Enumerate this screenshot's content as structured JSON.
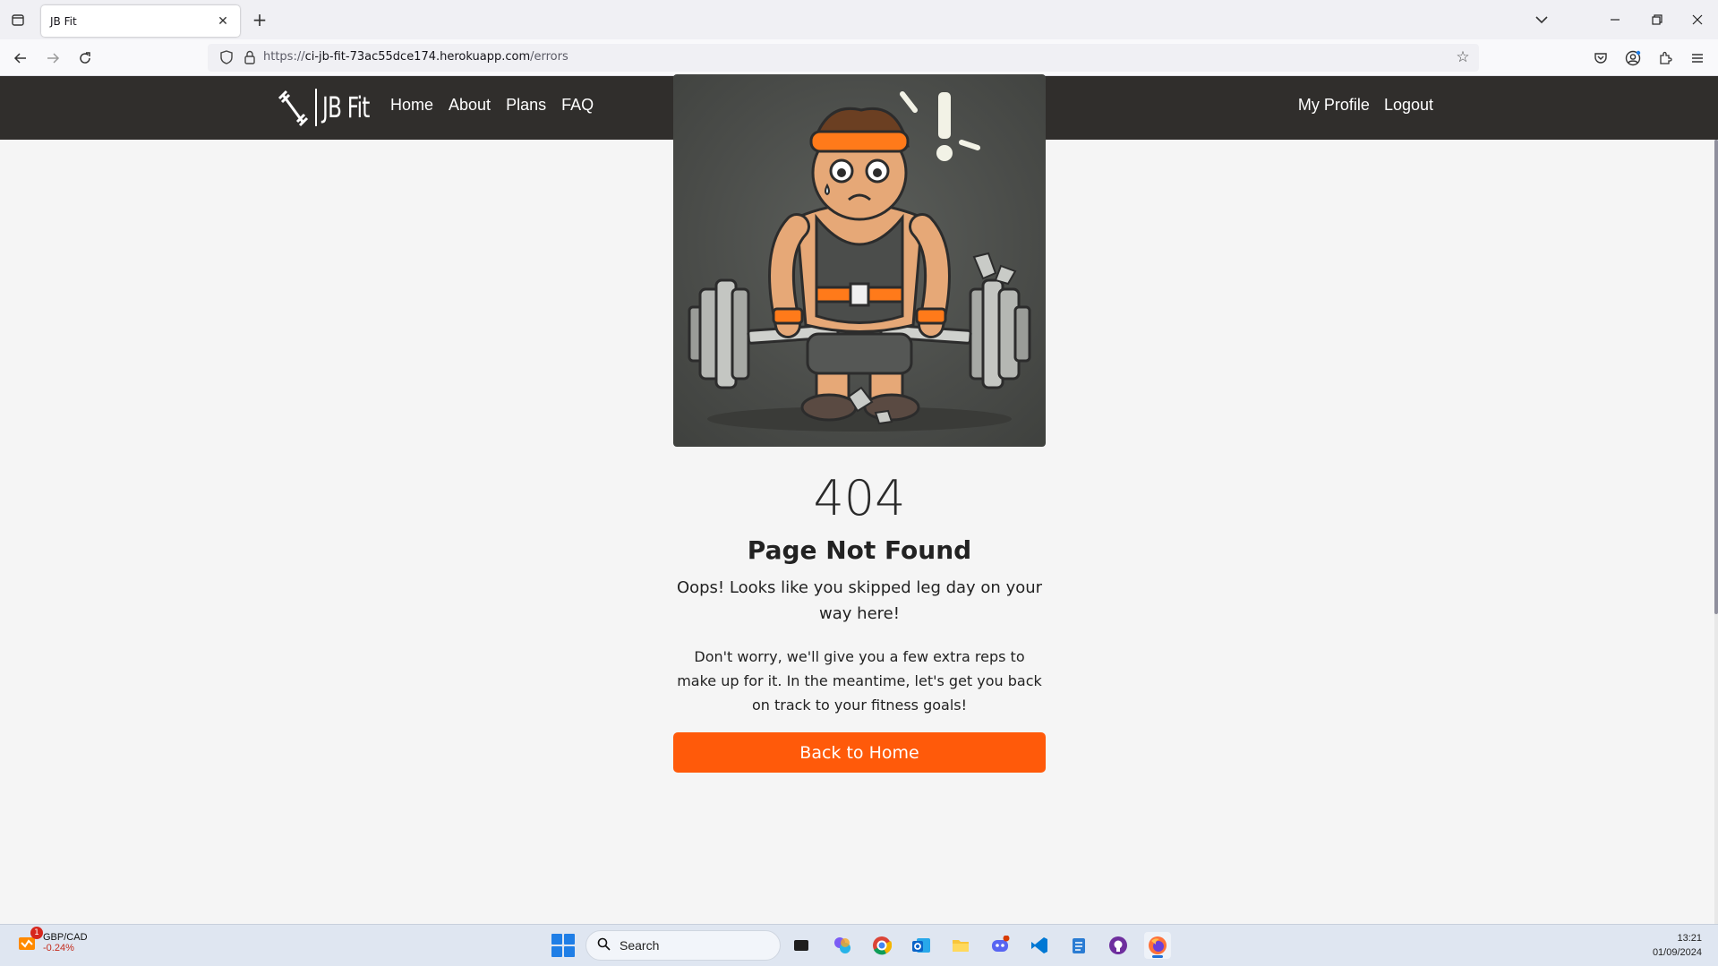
{
  "browser": {
    "tab_title": "JB Fit",
    "url_prefix": "https://",
    "url_domain": "ci-jb-fit-73ac55dce174.herokuapp.com",
    "url_path": "/errors"
  },
  "site": {
    "logo_text": "JB Fit",
    "nav": [
      "Home",
      "About",
      "Plans",
      "FAQ"
    ],
    "user_nav": [
      "My Profile",
      "Logout"
    ]
  },
  "error_page": {
    "code": "404",
    "title": "Page Not Found",
    "subtitle": "Oops! Looks like you skipped leg day on your way here!",
    "body": "Don't worry, we'll give you a few extra reps to make up for it. In the meantime, let's get you back on track to your fitness goals!",
    "button": "Back to Home"
  },
  "taskbar": {
    "widget_name": "GBP/CAD",
    "widget_value": "-0.24%",
    "widget_badge": "1",
    "search_label": "Search",
    "time": "13:21",
    "date": "01/09/2024"
  },
  "colors": {
    "header_bg": "#302e2c",
    "accent": "#ff5a0a",
    "page_bg": "#f5f5f5"
  }
}
